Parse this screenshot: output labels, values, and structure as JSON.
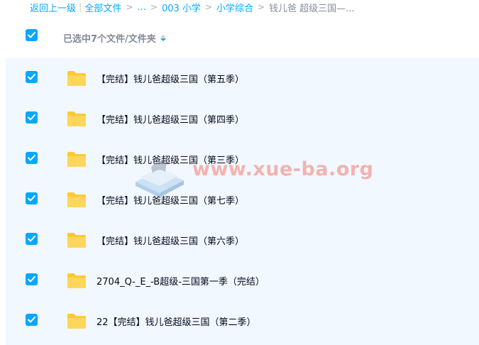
{
  "breadcrumb": {
    "back": "返回上一级",
    "items": [
      "全部文件",
      "...",
      "003 小学",
      "小学综合"
    ],
    "current": "钱儿爸 超级三国—..."
  },
  "header": {
    "selection_label": "已选中7个文件/文件夹"
  },
  "files": [
    {
      "name": "【完结】钱儿爸超级三国（第五季）",
      "checked": true
    },
    {
      "name": "【完结】钱儿爸超级三国（第四季）",
      "checked": true
    },
    {
      "name": "【完结】钱儿爸超级三国（第三季）",
      "checked": true
    },
    {
      "name": "【完结】钱儿爸超级三国（第七季）",
      "checked": true
    },
    {
      "name": "【完结】钱儿爸超级三国（第六季）",
      "checked": true
    },
    {
      "name": "2704_Q-_E_-B超级-三国第一季（完结）",
      "checked": true
    },
    {
      "name": "22【完结】钱儿爸超级三国（第二季）",
      "checked": true
    }
  ],
  "watermark": {
    "text": "www.xue-ba.org"
  },
  "colors": {
    "accent": "#06a7ff",
    "selected_row_bg": "#f1f8ff",
    "folder": "#ffd24d"
  }
}
